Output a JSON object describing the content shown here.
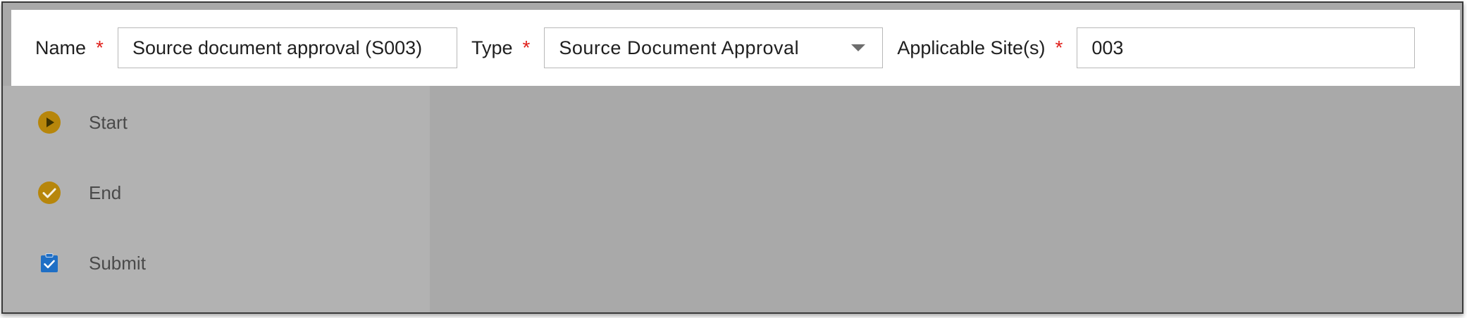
{
  "form": {
    "name_label": "Name",
    "name_value": "Source document approval (S003)",
    "type_label": "Type",
    "type_value": "Source Document Approval",
    "site_label": "Applicable Site(s)",
    "site_value": "003",
    "required_marker": "*"
  },
  "palette": {
    "items": [
      {
        "label": "Start",
        "icon": "play-circle-icon"
      },
      {
        "label": "End",
        "icon": "check-circle-icon"
      },
      {
        "label": "Submit",
        "icon": "clipboard-check-icon"
      }
    ]
  },
  "colors": {
    "required": "#e0201b",
    "event_icon": "#b7860b",
    "task_icon": "#1f6fc5",
    "overlay": "#a9a9a9"
  }
}
